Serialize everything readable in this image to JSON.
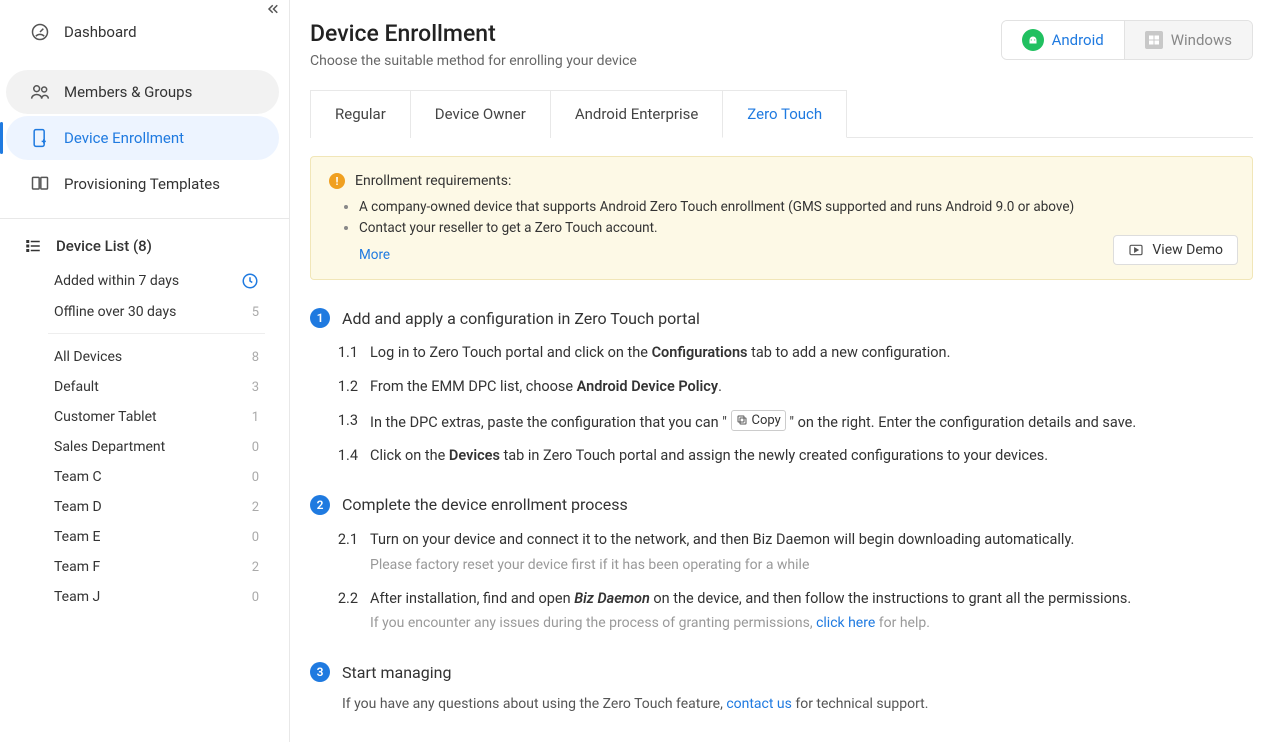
{
  "sidebar": {
    "dashboard": "Dashboard",
    "members": "Members & Groups",
    "enrollment": "Device Enrollment",
    "provisioning": "Provisioning Templates",
    "device_list_label": "Device List (8)",
    "filters": [
      {
        "label": "Added within 7 days",
        "count": ""
      },
      {
        "label": "Offline over 30 days",
        "count": "5"
      }
    ],
    "groups": [
      {
        "label": "All Devices",
        "count": "8"
      },
      {
        "label": "Default",
        "count": "3"
      },
      {
        "label": "Customer Tablet",
        "count": "1"
      },
      {
        "label": "Sales Department",
        "count": "0"
      },
      {
        "label": "Team C",
        "count": "0"
      },
      {
        "label": "Team D",
        "count": "2"
      },
      {
        "label": "Team E",
        "count": "0"
      },
      {
        "label": "Team F",
        "count": "2"
      },
      {
        "label": "Team J",
        "count": "0"
      }
    ]
  },
  "header": {
    "title": "Device Enrollment",
    "subtitle": "Choose the suitable method for enrolling your device",
    "android": "Android",
    "windows": "Windows"
  },
  "tabs": {
    "regular": "Regular",
    "device_owner": "Device Owner",
    "android_enterprise": "Android Enterprise",
    "zero_touch": "Zero Touch"
  },
  "requirements": {
    "title": "Enrollment requirements:",
    "items": [
      "A company-owned device that supports Android Zero Touch enrollment (GMS supported and runs Android 9.0 or above)",
      "Contact your reseller to get a Zero Touch account."
    ],
    "more": "More",
    "view_demo": "View Demo"
  },
  "steps": {
    "s1": {
      "title": "Add and apply a configuration in Zero Touch portal",
      "i1a": "Log in to Zero Touch portal and click on the ",
      "i1b": "Configurations",
      "i1c": " tab to add a new configuration.",
      "i2a": "From the EMM DPC list, choose ",
      "i2b": "Android Device Policy",
      "i2c": ".",
      "i3a": "In the DPC extras, paste the configuration that you can \" ",
      "i3copy": "Copy",
      "i3b": " \" on the right. Enter the configuration details and save.",
      "i4a": "Click on the ",
      "i4b": "Devices",
      "i4c": " tab in Zero Touch portal and assign the newly created configurations to your devices."
    },
    "s2": {
      "title": "Complete the device enrollment process",
      "i1": "Turn on your device and connect it to the network, and then Biz Daemon will begin downloading automatically.",
      "i1note": "Please factory reset your device first if it has been operating for a while",
      "i2a": "After installation, find and open ",
      "i2b": "Biz Daemon",
      "i2c": " on the device, and then follow the instructions to grant all the permissions.",
      "i2note_a": "If you encounter any issues during the process of granting permissions, ",
      "i2note_link": "click here",
      "i2note_b": " for help."
    },
    "s3": {
      "title": "Start managing",
      "footer_a": "If you have any questions about using the Zero Touch feature, ",
      "footer_link": "contact us",
      "footer_b": " for technical support."
    }
  }
}
